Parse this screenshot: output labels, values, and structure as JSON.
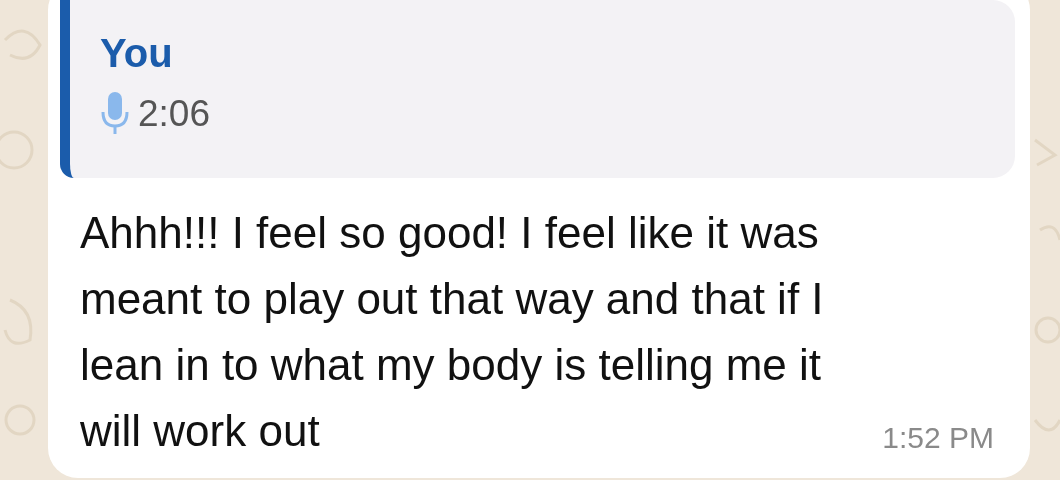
{
  "quote": {
    "author": "You",
    "duration": "2:06"
  },
  "message": {
    "text": "Ahhh!!! I feel so good! I feel like it was meant to play out that way and that if I lean in to what my body is telling me it will work out",
    "time": "1:52 PM"
  }
}
